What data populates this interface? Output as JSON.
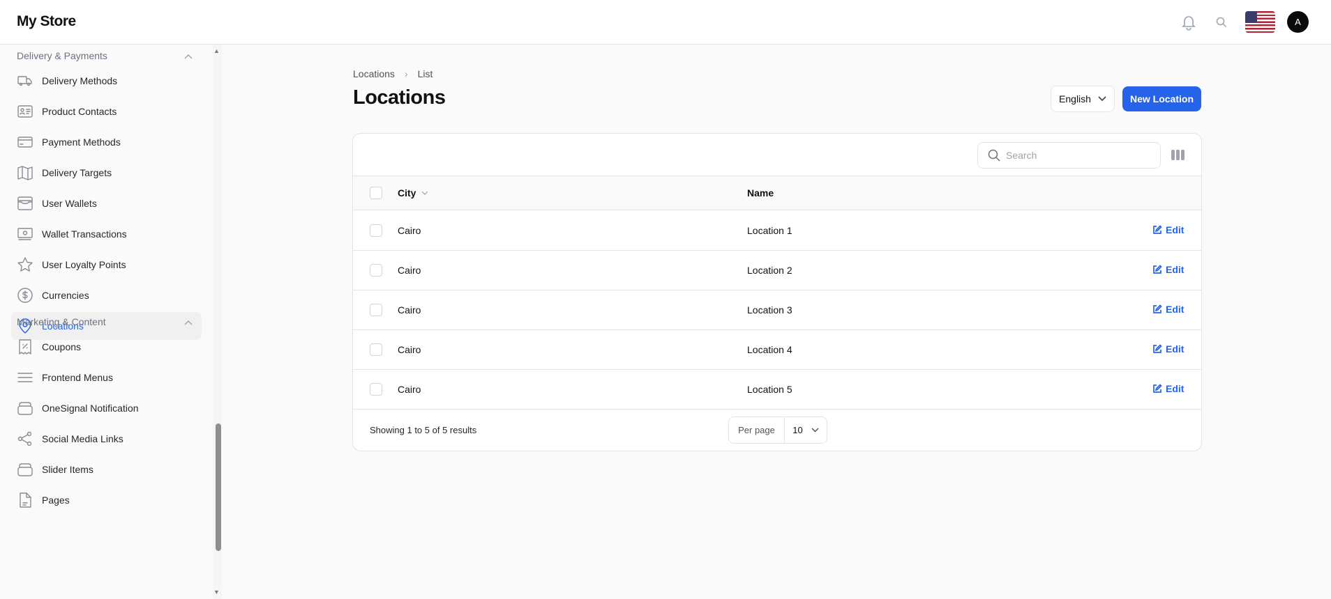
{
  "header": {
    "brand": "My Store",
    "avatar_initial": "A",
    "language_flag": "us-flag"
  },
  "sidebar": {
    "groups": [
      {
        "label": "Delivery & Payments",
        "items": [
          {
            "label": "Delivery Methods",
            "icon": "truck-icon"
          },
          {
            "label": "Product Contacts",
            "icon": "id-card-icon"
          },
          {
            "label": "Payment Methods",
            "icon": "credit-card-icon"
          },
          {
            "label": "Delivery Targets",
            "icon": "map-icon"
          },
          {
            "label": "User Wallets",
            "icon": "wallet-icon"
          },
          {
            "label": "Wallet Transactions",
            "icon": "banknotes-icon"
          },
          {
            "label": "User Loyalty Points",
            "icon": "star-icon"
          },
          {
            "label": "Currencies",
            "icon": "dollar-icon"
          },
          {
            "label": "Locations",
            "icon": "map-pin-icon",
            "active": true
          }
        ]
      },
      {
        "label": "Marketing & Content",
        "items": [
          {
            "label": "Coupons",
            "icon": "receipt-percent-icon"
          },
          {
            "label": "Frontend Menus",
            "icon": "bars-icon"
          },
          {
            "label": "OneSignal Notification",
            "icon": "stack-icon"
          },
          {
            "label": "Social Media Links",
            "icon": "share-icon"
          },
          {
            "label": "Slider Items",
            "icon": "stack-icon"
          },
          {
            "label": "Pages",
            "icon": "document-icon"
          }
        ]
      }
    ]
  },
  "main": {
    "breadcrumb": [
      "Locations",
      "List"
    ],
    "title": "Locations",
    "language": "English",
    "new_button": "New Location",
    "search_placeholder": "Search",
    "columns": {
      "city": "City",
      "name": "Name"
    },
    "edit_label": "Edit",
    "rows": [
      {
        "city": "Cairo",
        "name": "Location 1"
      },
      {
        "city": "Cairo",
        "name": "Location 2"
      },
      {
        "city": "Cairo",
        "name": "Location 3"
      },
      {
        "city": "Cairo",
        "name": "Location 4"
      },
      {
        "city": "Cairo",
        "name": "Location 5"
      }
    ],
    "footer": {
      "showing": "Showing 1 to 5 of 5 results",
      "per_page_label": "Per page",
      "per_page_value": "10"
    }
  },
  "colors": {
    "accent": "#2563eb"
  }
}
